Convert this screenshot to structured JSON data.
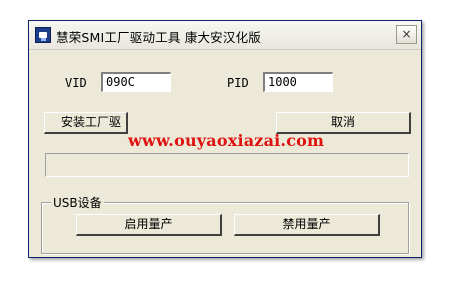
{
  "window": {
    "title": "慧荣SMI工厂驱动工具  康大安汉化版",
    "close_label": "×"
  },
  "vid": {
    "label": "VID",
    "value": "090C"
  },
  "pid": {
    "label": "PID",
    "value": "1000"
  },
  "buttons": {
    "install": "安装工厂驱",
    "cancel": "取消",
    "enable": "启用量产",
    "disable": "禁用量产"
  },
  "group": {
    "title": "USB设备"
  },
  "watermark": "www.ouyaoxiazai.com"
}
